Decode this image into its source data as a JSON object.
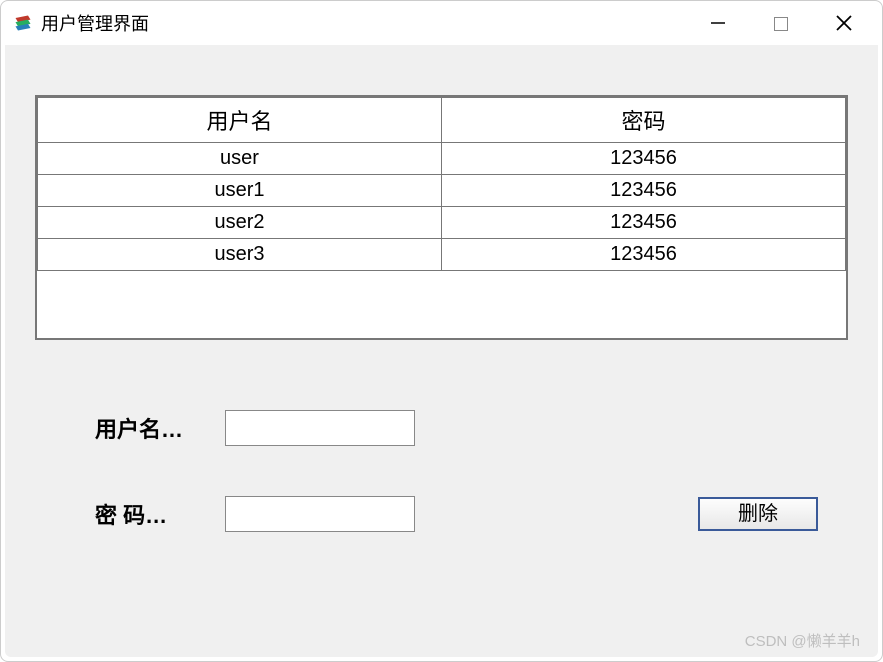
{
  "window": {
    "title": "用户管理界面"
  },
  "table": {
    "headers": {
      "username": "用户名",
      "password": "密码"
    },
    "rows": [
      {
        "username": "user",
        "password": "123456"
      },
      {
        "username": "user1",
        "password": "123456"
      },
      {
        "username": "user2",
        "password": "123456"
      },
      {
        "username": "user3",
        "password": "123456"
      }
    ]
  },
  "form": {
    "username_label": "用户名…",
    "password_label": "密  码…",
    "username_value": "",
    "password_value": ""
  },
  "buttons": {
    "delete": "删除"
  },
  "watermark": "CSDN @懒羊羊h"
}
